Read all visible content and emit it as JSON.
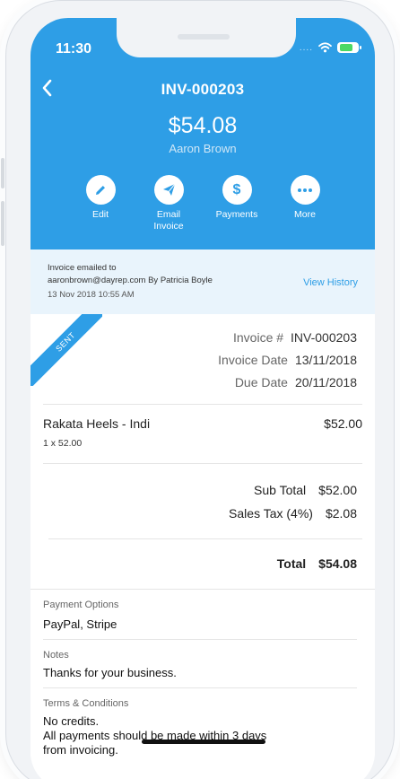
{
  "status_bar": {
    "time": "11:30",
    "signal": "....",
    "wifi_icon": "wifi-icon",
    "battery_icon": "battery-icon"
  },
  "header": {
    "back_icon": "chevron-left-icon",
    "invoice_number": "INV-000203",
    "amount": "$54.08",
    "customer_name": "Aaron Brown",
    "background_color": "#2e9ee6"
  },
  "actions": [
    {
      "icon": "pencil-icon",
      "label": "Edit"
    },
    {
      "icon": "paper-plane-icon",
      "label_line1": "Email",
      "label_line2": "Invoice"
    },
    {
      "icon": "dollar-icon",
      "label": "Payments"
    },
    {
      "icon": "more-dots-icon",
      "label": "More"
    }
  ],
  "email_info": {
    "line1": "Invoice emailed to",
    "line2": "aaronbrown@dayrep.com By Patricia Boyle",
    "timestamp": "13 Nov 2018 10:55 AM",
    "view_history": "View History"
  },
  "status_ribbon": "SENT",
  "invoice_meta": {
    "invoice_label": "Invoice #",
    "invoice_value": "INV-000203",
    "date_label": "Invoice Date",
    "date_value": "13/11/2018",
    "due_label": "Due Date",
    "due_value": "20/11/2018"
  },
  "line_item": {
    "name": "Rakata Heels - Indi",
    "qty": "1 x 52.00",
    "amount": "$52.00"
  },
  "totals": {
    "subtotal_label": "Sub Total",
    "subtotal_value": "$52.00",
    "tax_label": "Sales Tax (4%)",
    "tax_value": "$2.08",
    "total_label": "Total",
    "total_value": "$54.08"
  },
  "payment_options": {
    "label": "Payment Options",
    "value": "PayPal, Stripe"
  },
  "notes": {
    "label": "Notes",
    "value": "Thanks for your business."
  },
  "terms": {
    "label": "Terms & Conditions",
    "line1": "No credits.",
    "line2": "All payments should be made within 3 days",
    "line3": "from invoicing."
  }
}
